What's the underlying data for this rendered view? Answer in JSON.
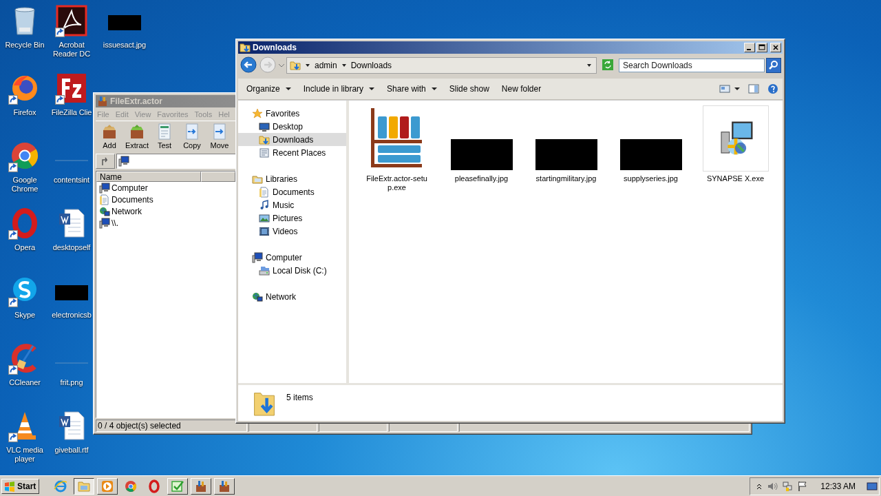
{
  "desktop_icons": [
    {
      "label": "Recycle Bin",
      "kind": "recycle",
      "shortcut": false
    },
    {
      "label": "Firefox",
      "kind": "firefox",
      "shortcut": true
    },
    {
      "label": "Google Chrome",
      "kind": "chrome",
      "shortcut": true
    },
    {
      "label": "Opera",
      "kind": "opera",
      "shortcut": true
    },
    {
      "label": "Skype",
      "kind": "skype",
      "shortcut": true
    },
    {
      "label": "CCleaner",
      "kind": "ccleaner",
      "shortcut": true
    },
    {
      "label": "VLC media player",
      "kind": "vlc",
      "shortcut": true
    },
    {
      "label": "Acrobat Reader DC",
      "kind": "acrobat",
      "shortcut": true
    },
    {
      "label": "FileZilla Clie",
      "kind": "filezilla",
      "shortcut": true
    },
    {
      "label": "contentsint",
      "kind": "blank-image",
      "shortcut": false
    },
    {
      "label": "desktopself",
      "kind": "word",
      "shortcut": false
    },
    {
      "label": "electronicsb",
      "kind": "hidden-image",
      "shortcut": false
    },
    {
      "label": "frit.png",
      "kind": "blank-image",
      "shortcut": false
    },
    {
      "label": "giveball.rtf",
      "kind": "word",
      "shortcut": false
    },
    {
      "label": "issuesact.jpg",
      "kind": "hidden-image",
      "shortcut": false
    }
  ],
  "fileextr_window": {
    "title": "FileExtr.actor",
    "menu": [
      "File",
      "Edit",
      "View",
      "Favorites",
      "Tools",
      "Hel"
    ],
    "toolbar": [
      {
        "label": "Add",
        "kind": "add"
      },
      {
        "label": "Extract",
        "kind": "extract"
      },
      {
        "label": "Test",
        "kind": "test"
      },
      {
        "label": "Copy",
        "kind": "copy"
      },
      {
        "label": "Move",
        "kind": "move"
      }
    ],
    "columns": [
      "Name"
    ],
    "rows": [
      {
        "name": "Computer",
        "kind": "computer"
      },
      {
        "name": "Documents",
        "kind": "documents"
      },
      {
        "name": "Network",
        "kind": "network"
      },
      {
        "name": "\\\\.",
        "kind": "computer"
      }
    ],
    "status": "0 / 4 object(s) selected"
  },
  "explorer_window": {
    "title": "Downloads",
    "breadcrumbs": [
      "admin",
      "Downloads"
    ],
    "search": {
      "placeholder": "Search Downloads"
    },
    "commands": [
      {
        "label": "Organize",
        "dropdown": true
      },
      {
        "label": "Include in library",
        "dropdown": true
      },
      {
        "label": "Share with",
        "dropdown": true
      },
      {
        "label": "Slide show",
        "dropdown": false
      },
      {
        "label": "New folder",
        "dropdown": false
      }
    ],
    "nav_pane": [
      {
        "label": "Favorites",
        "kind": "star",
        "selected": false,
        "children": [
          {
            "label": "Desktop",
            "kind": "desktop",
            "selected": false
          },
          {
            "label": "Downloads",
            "kind": "downloads",
            "selected": true
          },
          {
            "label": "Recent Places",
            "kind": "recent",
            "selected": false
          }
        ]
      },
      {
        "label": "Libraries",
        "kind": "library",
        "selected": false,
        "children": [
          {
            "label": "Documents",
            "kind": "documents",
            "selected": false
          },
          {
            "label": "Music",
            "kind": "music",
            "selected": false
          },
          {
            "label": "Pictures",
            "kind": "pictures",
            "selected": false
          },
          {
            "label": "Videos",
            "kind": "videos",
            "selected": false
          }
        ]
      },
      {
        "label": "Computer",
        "kind": "computer",
        "selected": false,
        "children": [
          {
            "label": "Local Disk (C:)",
            "kind": "disk",
            "selected": false
          }
        ]
      },
      {
        "label": "Network",
        "kind": "network",
        "selected": false
      }
    ],
    "files": [
      {
        "name": "FileExtr.actor-setup.exe",
        "kind": "app"
      },
      {
        "name": "pleasefinally.jpg",
        "kind": "hidden-image"
      },
      {
        "name": "startingmilitary.jpg",
        "kind": "hidden-image"
      },
      {
        "name": "supplyseries.jpg",
        "kind": "hidden-image"
      },
      {
        "name": "SYNAPSE X.exe",
        "kind": "installer"
      }
    ],
    "details": {
      "count": "5 items"
    }
  },
  "taskbar": {
    "start": "Start",
    "apps": [
      {
        "kind": "ie",
        "running": false,
        "selected": false
      },
      {
        "kind": "folder",
        "running": true,
        "selected": true
      },
      {
        "kind": "media",
        "running": true,
        "selected": false
      },
      {
        "kind": "chrome",
        "running": false,
        "selected": false
      },
      {
        "kind": "opera",
        "running": false,
        "selected": false
      },
      {
        "kind": "check",
        "running": true,
        "selected": false
      },
      {
        "kind": "archive",
        "running": true,
        "selected": false
      },
      {
        "kind": "archive",
        "running": true,
        "selected": false
      }
    ],
    "time": "12:33 AM"
  }
}
